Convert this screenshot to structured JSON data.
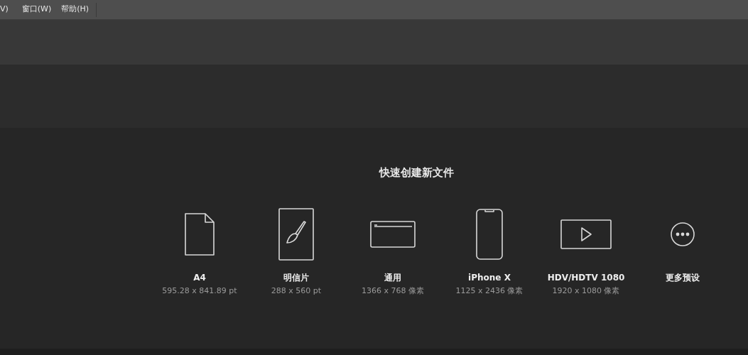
{
  "menu_bar": [
    {
      "label": "V)"
    },
    {
      "label": "窗口(W)"
    },
    {
      "label": "帮助(H)"
    }
  ],
  "quick_create": {
    "title": "快速创建新文件",
    "presets": [
      {
        "kind": "document",
        "name": "A4",
        "size": "595.28 x 841.89 pt"
      },
      {
        "kind": "brush",
        "name": "明信片",
        "size": "288 x 560 pt"
      },
      {
        "kind": "window",
        "name": "通用",
        "size": "1366 x 768 像素"
      },
      {
        "kind": "phone",
        "name": "iPhone X",
        "size": "1125 x 2436 像素"
      },
      {
        "kind": "video",
        "name": "HDV/HDTV 1080",
        "size": "1920 x 1080 像素"
      },
      {
        "kind": "more",
        "name": "更多预设"
      }
    ]
  }
}
